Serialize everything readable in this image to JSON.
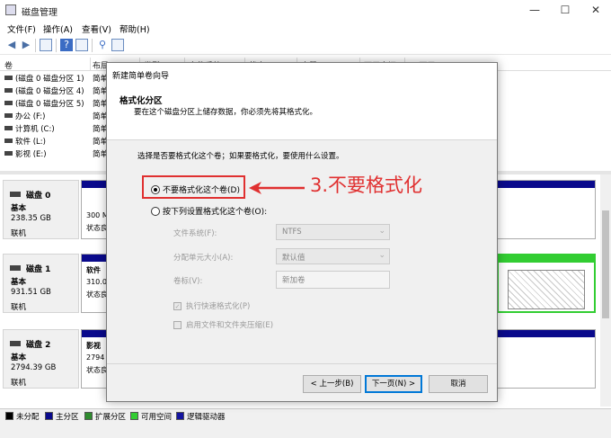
{
  "window": {
    "title": "磁盘管理",
    "minimize": "—",
    "maximize": "☐",
    "close": "✕"
  },
  "menu": [
    "文件(F)",
    "操作(A)",
    "查看(V)",
    "帮助(H)"
  ],
  "toolbar": {
    "back": "◀",
    "forward": "▶",
    "help": "?"
  },
  "volume_table": {
    "headers": [
      "卷",
      "布局",
      "类型",
      "文件系统",
      "状态",
      "容量",
      "可用空间",
      "% 可用"
    ],
    "rows": [
      {
        "name": "(磁盘 0 磁盘分区 1)",
        "layout": "简单"
      },
      {
        "name": "(磁盘 0 磁盘分区 4)",
        "layout": "简单"
      },
      {
        "name": "(磁盘 0 磁盘分区 5)",
        "layout": "简单"
      },
      {
        "name": "办公 (F:)",
        "layout": "简单"
      },
      {
        "name": "计算机 (C:)",
        "layout": "简单"
      },
      {
        "name": "软件 (L:)",
        "layout": "简单"
      },
      {
        "name": "影视 (E:)",
        "layout": "简单"
      }
    ]
  },
  "disks": [
    {
      "name": "磁盘 0",
      "type": "基本",
      "size": "238.35 GB",
      "status": "联机",
      "part_size": "300 M",
      "part_status": "状态良"
    },
    {
      "name": "磁盘 1",
      "type": "基本",
      "size": "931.51 GB",
      "status": "联机",
      "part_label": "软件",
      "part_size": "310.0",
      "part_status": "状态良"
    },
    {
      "name": "磁盘 2",
      "type": "基本",
      "size": "2794.39 GB",
      "status": "联机",
      "part_label": "影视",
      "part_size": "2794",
      "part_status": "状态良"
    }
  ],
  "legend": [
    {
      "label": "未分配",
      "color": "#000000"
    },
    {
      "label": "主分区",
      "color": "#0a0a8c"
    },
    {
      "label": "扩展分区",
      "color": "#2e8b2e"
    },
    {
      "label": "可用空间",
      "color": "#32cd32"
    },
    {
      "label": "逻辑驱动器",
      "color": "#1414a0"
    }
  ],
  "dialog": {
    "title": "新建简单卷向导",
    "heading": "格式化分区",
    "subheading": "要在这个磁盘分区上储存数据，你必须先将其格式化。",
    "prompt": "选择是否要格式化这个卷；如果要格式化，要使用什么设置。",
    "option_no_format": "不要格式化这个卷(D)",
    "option_format": "按下列设置格式化这个卷(O):",
    "fs_label": "文件系统(F):",
    "fs_value": "NTFS",
    "alloc_label": "分配单元大小(A):",
    "alloc_value": "默认值",
    "vol_label": "卷标(V):",
    "vol_value": "新加卷",
    "quick_format": "执行快速格式化(P)",
    "compress": "启用文件和文件夹压缩(E)",
    "back_btn": "< 上一步(B)",
    "next_btn": "下一页(N) >",
    "cancel_btn": "取消"
  },
  "annotation": "3.不要格式化",
  "colors": {
    "highlight": "#e03030",
    "primary_partition": "#0a0a8c",
    "extended": "#2e8b2e",
    "free_space": "#32cd32",
    "accent": "#0078d7"
  }
}
